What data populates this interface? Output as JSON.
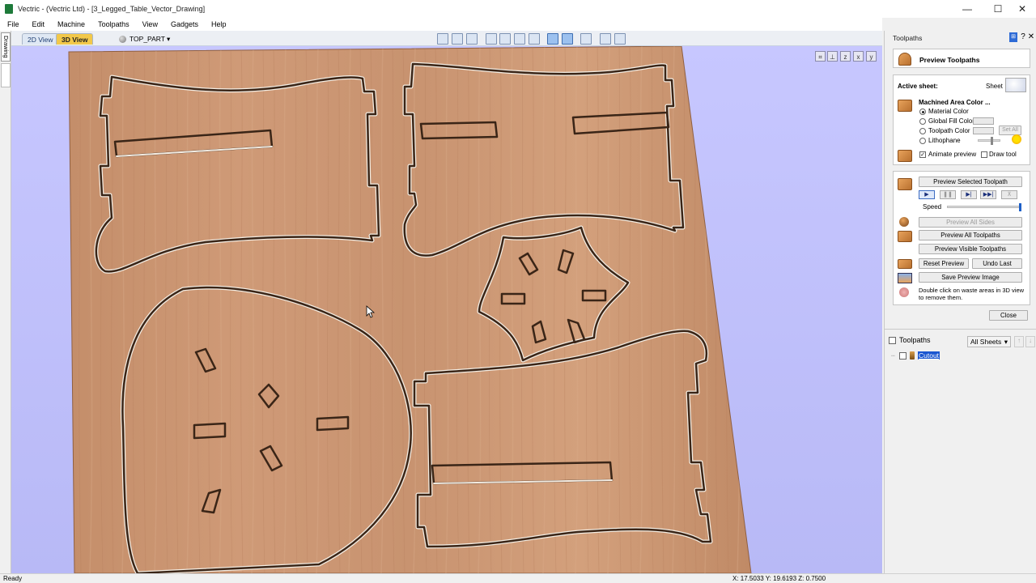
{
  "window": {
    "title": "Vectric - (Vectric Ltd) - [3_Legged_Table_Vector_Drawing]",
    "controls": [
      "—",
      "☐",
      "✕"
    ]
  },
  "menu": [
    "File",
    "Edit",
    "Machine",
    "Toolpaths",
    "View",
    "Gadgets",
    "Help"
  ],
  "view_tabs": {
    "tab_2d": "2D View",
    "tab_3d": "3D View",
    "sheet": "TOP_PART"
  },
  "left_strip": {
    "drawing_tab": "Drawing"
  },
  "panel": {
    "header": "Toolpaths",
    "preview": {
      "title": "Preview Toolpaths",
      "active_sheet_label": "Active sheet:",
      "sheet_label": "Sheet",
      "machined_label": "Machined Area Color ...",
      "options": [
        "Material Color",
        "Global Fill Color",
        "Toolpath Color",
        "Lithophane"
      ],
      "selected_option": "Material Color",
      "set_all": "Set All",
      "animate_preview": "Animate preview",
      "draw_tool": "Draw tool",
      "preview_selected": "Preview Selected Toolpath",
      "speed_label": "Speed",
      "speed_level": 1.0,
      "preview_all_sides": "Preview All Sides",
      "preview_all": "Preview All Toolpaths",
      "preview_visible": "Preview Visible Toolpaths",
      "reset_preview": "Reset Preview",
      "undo_last": "Undo Last",
      "save_image": "Save Preview Image",
      "hint": "Double click on waste areas in 3D view to remove them.",
      "close": "Close"
    },
    "toolpaths": {
      "heading": "Toolpaths",
      "sheet_filter": "All Sheets",
      "items": [
        "Cutout"
      ]
    }
  },
  "status": {
    "left": "Ready",
    "coords": "X: 17.5033 Y: 19.6193 Z: 0.7500"
  }
}
